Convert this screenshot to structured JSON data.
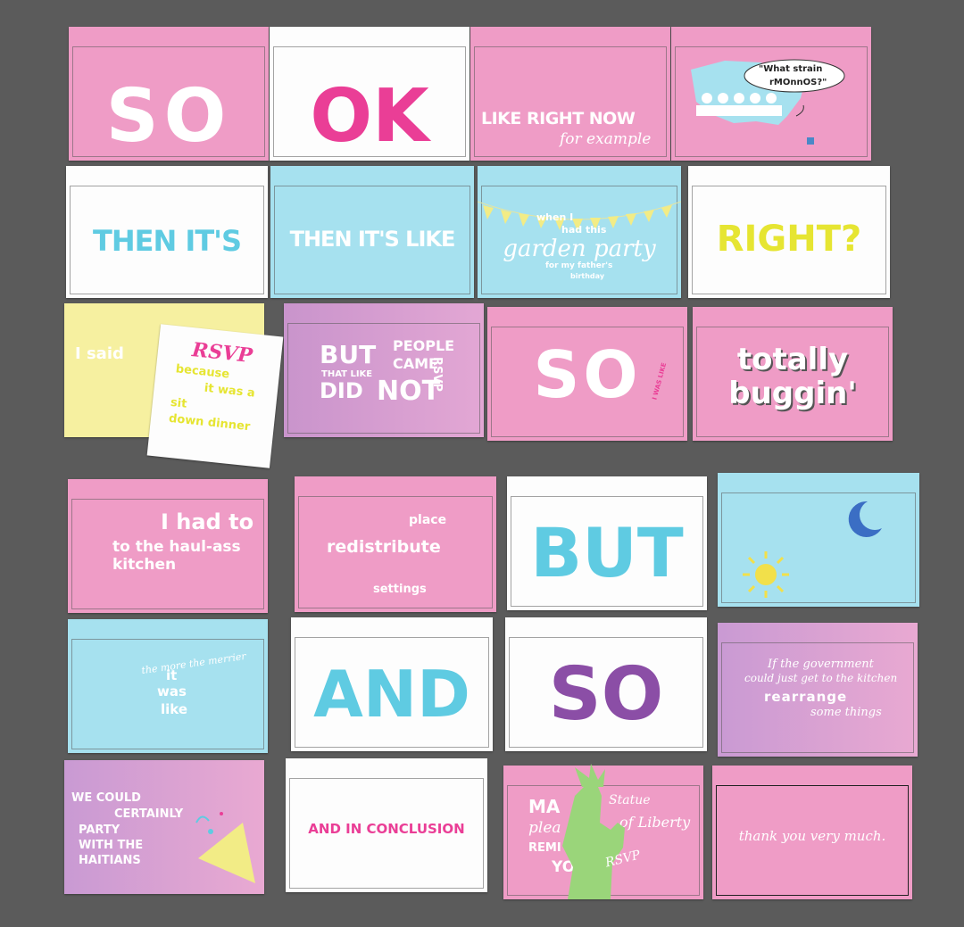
{
  "cards": {
    "so1": "SO",
    "ok": "OK",
    "like_right_now": "LIKE RIGHT NOW",
    "for_example": "for example",
    "map_bubble_1": "\"What strain",
    "map_bubble_2": "rMOnnOS?\"",
    "then_its": "THEN IT'S",
    "then_its_like": "THEN IT'S LIKE",
    "when_i": "when I",
    "had_this": "had this",
    "garden_party": "garden party",
    "fathers_bday": "for my father's",
    "birthday": "birthday",
    "right": "RIGHT?",
    "i_said": "I said",
    "rsvp": "RSVP",
    "because": "because",
    "it_was_a": "it was a",
    "sit": "sit",
    "down_dinner": "down dinner",
    "but": "BUT",
    "people": "PEOPLE",
    "came": "CAME",
    "that_like": "THAT LIKE",
    "did": "DID",
    "not": "NOT",
    "rsvp_vert": "RSVP",
    "so2": "SO",
    "i_was_like": "I WAS LIKE",
    "totally": "totally",
    "buggin": "buggin'",
    "i_had_to": "I had to",
    "to_the_haul": "to the haul-ass",
    "kitchen": "kitchen",
    "place": "place",
    "redistribute": "redistribute",
    "settings": "settings",
    "but2": "BUT",
    "the_more_the_merrier": "the more the merrier",
    "it": "it",
    "was": "was",
    "like": "like",
    "and": "AND",
    "so3": "SO",
    "if_gov": "If the government",
    "could_just": "could just get to the kitchen",
    "rearrange": "rearrange",
    "some_things": "some things",
    "we_could": "WE COULD",
    "certainly": "CERTAINLY",
    "party": "PARTY",
    "with_the": "WITH THE",
    "haitians": "HAITIANS",
    "and_in_conclusion": "AND IN CONCLUSION",
    "ma": "MA",
    "plea": "plea",
    "remi": "REMI",
    "yo": "YO",
    "statue": "Statue",
    "of_liberty": "of Liberty",
    "rsvp_statue": "RSVP",
    "thank_you": "thank you very much."
  },
  "colors": {
    "pink": "#ef9cc6",
    "hot_pink": "#ea3e96",
    "blue": "#a6e1ef",
    "cyan_text": "#5fcbe2",
    "yellow": "#f6f0a0",
    "yellow_text": "#e6e532",
    "purple_text": "#8b4ea6",
    "green_statue": "#9ad57a"
  },
  "icons": [
    "usa-map-icon",
    "bunting-icon",
    "moon-icon",
    "sun-icon",
    "confetti-icon",
    "statue-of-liberty-icon"
  ]
}
